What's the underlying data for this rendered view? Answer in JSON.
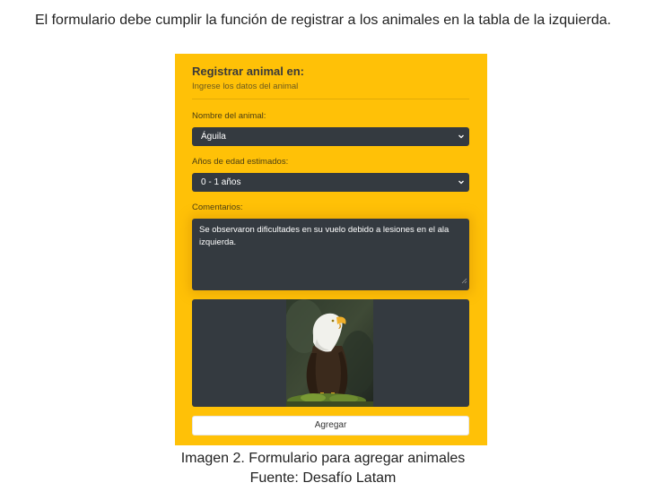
{
  "intro_text": "El formulario debe cumplir la función de registrar a los animales en la tabla de la izquierda.",
  "form": {
    "title": "Registrar animal en:",
    "subtitle": "Ingrese los datos del animal",
    "name_label": "Nombre del animal:",
    "name_value": "Águila",
    "age_label": "Años de edad estimados:",
    "age_value": "0 - 1 años",
    "comments_label": "Comentarios:",
    "comments_value": "Se observaron dificultades en su vuelo debido a lesiones en el ala izquierda.",
    "submit_label": "Agregar",
    "preview_image": "eagle-photo"
  },
  "caption": {
    "line1": "Imagen 2. Formulario para agregar animales",
    "line2": "Fuente: Desafío Latam"
  },
  "colors": {
    "panel_background": "#ffc107",
    "field_background": "#343a40",
    "button_background": "#ffffff"
  },
  "icons": {
    "select_arrow": "chevron-down-icon"
  }
}
